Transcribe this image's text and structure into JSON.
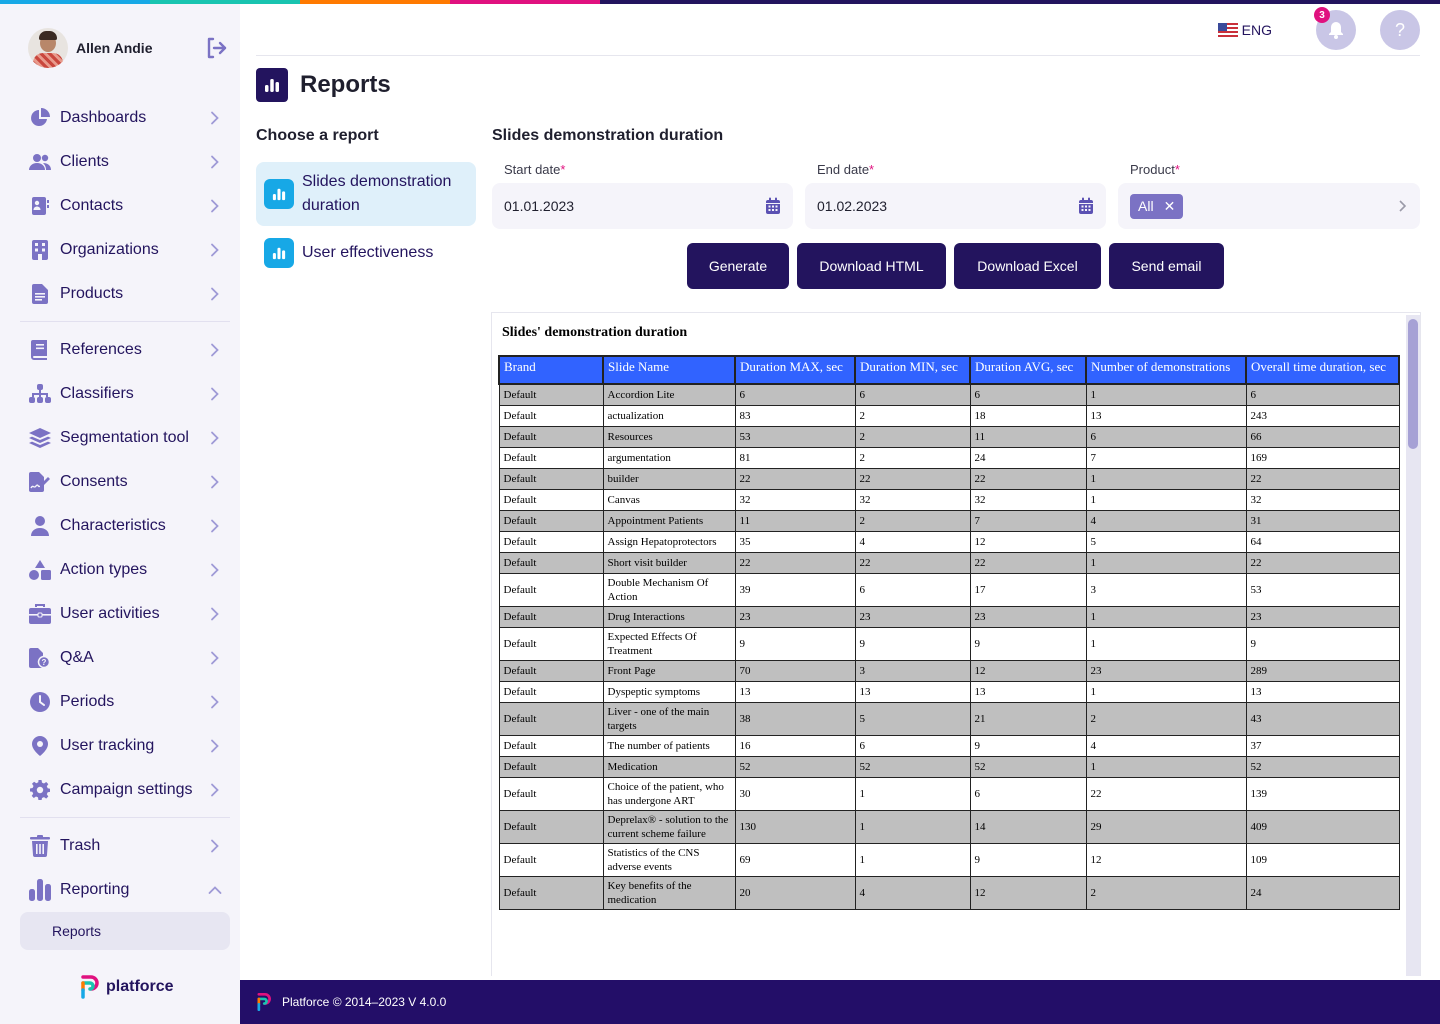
{
  "topstrip_colors": [
    "#17a8e6",
    "#19c4b0",
    "#ff7a00",
    "#e0117f",
    "#23145e"
  ],
  "user": {
    "name": "Allen Andie"
  },
  "sidebar": {
    "groups": [
      [
        {
          "label": "Dashboards",
          "icon": "pie-chart-icon"
        },
        {
          "label": "Clients",
          "icon": "users-icon"
        },
        {
          "label": "Contacts",
          "icon": "contact-card-icon"
        },
        {
          "label": "Organizations",
          "icon": "building-icon"
        },
        {
          "label": "Products",
          "icon": "document-icon"
        }
      ],
      [
        {
          "label": "References",
          "icon": "book-icon"
        },
        {
          "label": "Classifiers",
          "icon": "hierarchy-icon"
        },
        {
          "label": "Segmentation tool",
          "icon": "layers-icon"
        },
        {
          "label": "Consents",
          "icon": "signed-document-icon"
        },
        {
          "label": "Characteristics",
          "icon": "user-icon"
        },
        {
          "label": "Action types",
          "icon": "shapes-icon"
        },
        {
          "label": "User activities",
          "icon": "briefcase-icon"
        },
        {
          "label": "Q&A",
          "icon": "question-document-icon"
        },
        {
          "label": "Periods",
          "icon": "clock-icon"
        },
        {
          "label": "User tracking",
          "icon": "map-pin-icon"
        },
        {
          "label": "Campaign settings",
          "icon": "gear-icon"
        }
      ],
      [
        {
          "label": "Trash",
          "icon": "trash-icon"
        },
        {
          "label": "Reporting",
          "icon": "bar-chart-icon",
          "expanded": true
        }
      ]
    ],
    "sub_item": "Reports",
    "brand": "platforce"
  },
  "header": {
    "language": "ENG",
    "notifications_count": "3",
    "help": "?"
  },
  "page": {
    "title": "Reports",
    "choose_label": "Choose a report",
    "reports": [
      {
        "label": "Slides demonstration duration",
        "active": true
      },
      {
        "label": "User effectiveness",
        "active": false
      }
    ],
    "report_title": "Slides demonstration duration",
    "fields": {
      "start_date": {
        "label": "Start date",
        "required": "*",
        "value": "01.01.2023"
      },
      "end_date": {
        "label": "End date",
        "required": "*",
        "value": "01.02.2023"
      },
      "product": {
        "label": "Product",
        "required": "*",
        "chip": "All"
      }
    },
    "buttons": {
      "generate": "Generate",
      "download_html": "Download HTML",
      "download_excel": "Download Excel",
      "send_email": "Send email"
    }
  },
  "report_table": {
    "title": "Slides' demonstration duration",
    "columns": [
      "Brand",
      "Slide Name",
      "Duration MAX, sec",
      "Duration MIN, sec",
      "Duration AVG, sec",
      "Number of demonstrations",
      "Overall time duration, sec"
    ],
    "rows": [
      [
        "Default",
        "Accordion Lite",
        "6",
        "6",
        "6",
        "1",
        "6"
      ],
      [
        "Default",
        "actualization",
        "83",
        "2",
        "18",
        "13",
        "243"
      ],
      [
        "Default",
        "Resources",
        "53",
        "2",
        "11",
        "6",
        "66"
      ],
      [
        "Default",
        "argumentation",
        "81",
        "2",
        "24",
        "7",
        "169"
      ],
      [
        "Default",
        "builder",
        "22",
        "22",
        "22",
        "1",
        "22"
      ],
      [
        "Default",
        "Canvas",
        "32",
        "32",
        "32",
        "1",
        "32"
      ],
      [
        "Default",
        "Appointment Patients",
        "11",
        "2",
        "7",
        "4",
        "31"
      ],
      [
        "Default",
        "Assign Hepatoprotectors",
        "35",
        "4",
        "12",
        "5",
        "64"
      ],
      [
        "Default",
        "Short visit builder",
        "22",
        "22",
        "22",
        "1",
        "22"
      ],
      [
        "Default",
        "Double Mechanism Of Action",
        "39",
        "6",
        "17",
        "3",
        "53"
      ],
      [
        "Default",
        "Drug Interactions",
        "23",
        "23",
        "23",
        "1",
        "23"
      ],
      [
        "Default",
        "Expected Effects Of Treatment",
        "9",
        "9",
        "9",
        "1",
        "9"
      ],
      [
        "Default",
        "Front Page",
        "70",
        "3",
        "12",
        "23",
        "289"
      ],
      [
        "Default",
        "Dyspeptic symptoms",
        "13",
        "13",
        "13",
        "1",
        "13"
      ],
      [
        "Default",
        "Liver - one of the main targets",
        "38",
        "5",
        "21",
        "2",
        "43"
      ],
      [
        "Default",
        "The number of patients",
        "16",
        "6",
        "9",
        "4",
        "37"
      ],
      [
        "Default",
        "Medication",
        "52",
        "52",
        "52",
        "1",
        "52"
      ],
      [
        "Default",
        "Choice of the patient, who has undergone ART",
        "30",
        "1",
        "6",
        "22",
        "139"
      ],
      [
        "Default",
        "Deprelax® - solution to the current scheme failure",
        "130",
        "1",
        "14",
        "29",
        "409"
      ],
      [
        "Default",
        "Statistics of the CNS adverse events",
        "69",
        "1",
        "9",
        "12",
        "109"
      ],
      [
        "Default",
        "Key benefits of the medication",
        "20",
        "4",
        "12",
        "2",
        "24"
      ]
    ]
  },
  "footer": {
    "text": "Platforce © 2014–2023 V 4.0.0"
  }
}
